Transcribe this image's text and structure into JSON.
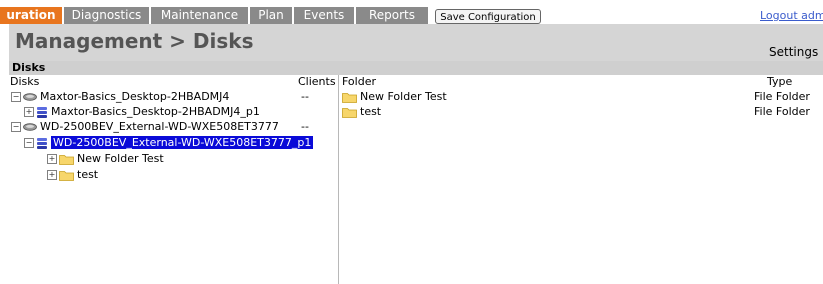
{
  "nav": {
    "tabs": [
      {
        "label": "uration",
        "active": true
      },
      {
        "label": "Diagnostics",
        "active": false
      },
      {
        "label": "Maintenance",
        "active": false
      },
      {
        "label": "Plan",
        "active": false
      },
      {
        "label": "Events",
        "active": false
      },
      {
        "label": "Reports",
        "active": false
      }
    ],
    "save_label": "Save Configuration",
    "logout_label": "Logout admi"
  },
  "page": {
    "title": "Management > Disks",
    "settings_label": "Settings"
  },
  "panel": {
    "title": "Disks",
    "columns": {
      "disks": "Disks",
      "clients": "Clients",
      "folder": "Folder",
      "type": "Type"
    }
  },
  "disk_tree": [
    {
      "label": "Maxtor-Basics_Desktop-2HBADMJ4",
      "clients": "--",
      "expander": "−",
      "icon": "hard-disk-icon"
    },
    {
      "label": "Maxtor-Basics_Desktop-2HBADMJ4_p1",
      "clients": "",
      "expander": "+",
      "icon": "partition-icon"
    },
    {
      "label": "WD-2500BEV_External-WD-WXE508ET3777",
      "clients": "--",
      "expander": "−",
      "icon": "hard-disk-icon"
    },
    {
      "label": "WD-2500BEV_External-WD-WXE508ET3777_p1",
      "clients": "",
      "expander": "−",
      "icon": "partition-icon",
      "selected": true
    },
    {
      "label": "New Folder Test",
      "clients": "",
      "expander": "+",
      "icon": "folder-icon"
    },
    {
      "label": "test",
      "clients": "",
      "expander": "+",
      "icon": "folder-icon"
    }
  ],
  "folders": [
    {
      "name": "New Folder Test",
      "type": "File Folder"
    },
    {
      "name": "test",
      "type": "File Folder"
    }
  ],
  "colors": {
    "accent": "#e8751e",
    "selection": "#0a0ad8",
    "link": "#3b5ccc"
  }
}
